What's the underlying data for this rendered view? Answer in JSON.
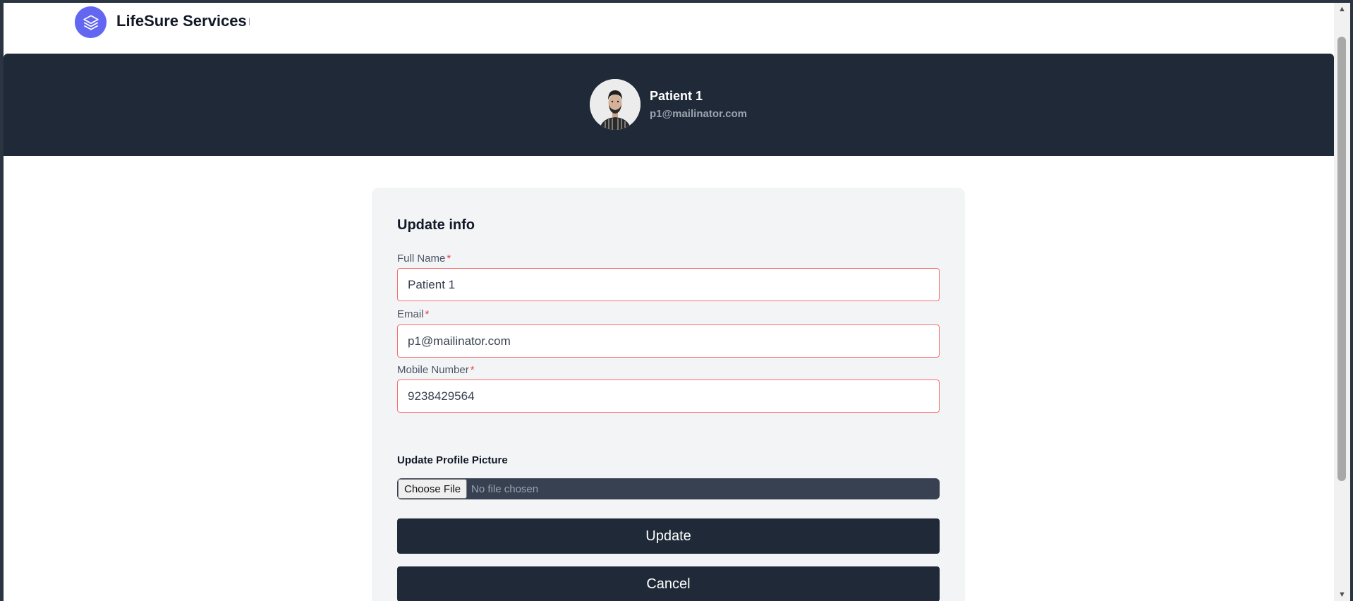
{
  "navbar": {
    "brand_name": "LifeSure Services",
    "logo_icon": "stacked-layers-icon",
    "brand_color": "#6366f1"
  },
  "profile": {
    "name": "Patient 1",
    "email": "p1@mailinator.com",
    "avatar_icon": "user-avatar-photo"
  },
  "form": {
    "title": "Update info",
    "required_marker": "*",
    "full_name": {
      "label": "Full Name",
      "value": "Patient 1"
    },
    "email": {
      "label": "Email",
      "value": "p1@mailinator.com"
    },
    "mobile": {
      "label": "Mobile Number",
      "value": "9238429564"
    },
    "picture": {
      "label": "Update Profile Picture",
      "button_label": "Choose File",
      "status": "No file chosen"
    },
    "update_label": "Update",
    "cancel_label": "Cancel"
  },
  "colors": {
    "header_bg": "#1f2937",
    "card_bg": "#f3f4f6",
    "error_border": "#f87171",
    "required": "#ef4444"
  }
}
